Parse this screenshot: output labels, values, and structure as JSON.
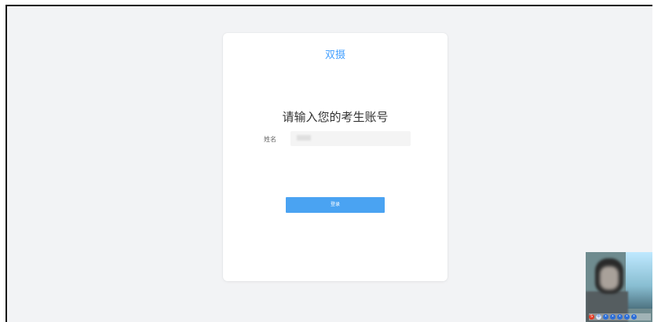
{
  "app": {
    "brand": "双摄",
    "title": "请输入您的考生账号"
  },
  "form": {
    "name_label": "姓名",
    "name_value": "",
    "name_placeholder": "",
    "login_label": "登录"
  },
  "webcam": {
    "caption": "",
    "icons": [
      {
        "name": "s-icon",
        "glyph": "S"
      },
      {
        "name": "chinese-input-icon",
        "glyph": "中"
      },
      {
        "name": "settings-icon",
        "glyph": "•"
      },
      {
        "name": "microphone-icon",
        "glyph": "•"
      },
      {
        "name": "keyboard-icon",
        "glyph": "•"
      },
      {
        "name": "user-icon",
        "glyph": "•"
      },
      {
        "name": "more-icon",
        "glyph": "•"
      }
    ]
  },
  "colors": {
    "accent": "#4aa3f2",
    "background": "#f2f3f5",
    "card": "#ffffff"
  }
}
